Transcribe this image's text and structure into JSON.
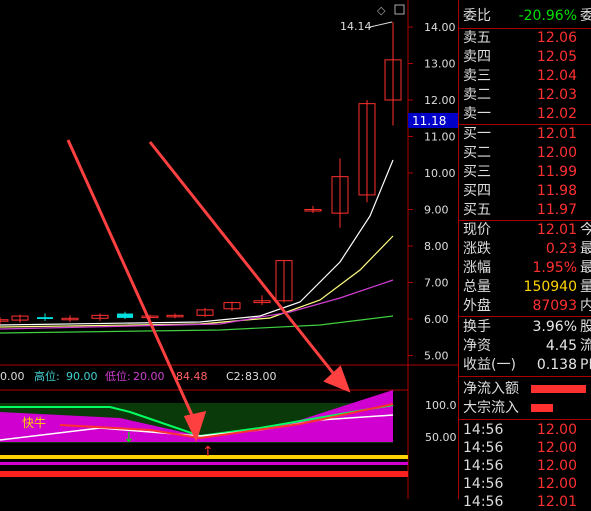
{
  "colors": {
    "up": "#ff3030",
    "down": "#00e000",
    "axis": "#b00000",
    "ma1": "#ffffff",
    "ma2": "#ffff80",
    "ma3": "#d040d0",
    "ma4": "#40d040",
    "arrow": "#ff4040"
  },
  "price_axis": {
    "ticks": [
      "14.00",
      "13.00",
      "12.00",
      "11.00",
      "10.00",
      "9.00",
      "8.00",
      "7.00",
      "6.00",
      "5.00"
    ],
    "current_marker": "11.18"
  },
  "high_label": "14.14",
  "candles": [
    {
      "o": 5.95,
      "h": 6.05,
      "l": 5.85,
      "c": 5.98
    },
    {
      "o": 5.97,
      "h": 6.12,
      "l": 5.9,
      "c": 6.08
    },
    {
      "o": 6.05,
      "h": 6.15,
      "l": 5.95,
      "c": 6.0
    },
    {
      "o": 6.0,
      "h": 6.1,
      "l": 5.92,
      "c": 6.02
    },
    {
      "o": 6.02,
      "h": 6.15,
      "l": 5.95,
      "c": 6.1
    },
    {
      "o": 6.15,
      "h": 6.2,
      "l": 6.0,
      "c": 6.03
    },
    {
      "o": 6.05,
      "h": 6.12,
      "l": 6.0,
      "c": 6.08
    },
    {
      "o": 6.08,
      "h": 6.15,
      "l": 6.02,
      "c": 6.1
    },
    {
      "o": 6.1,
      "h": 6.3,
      "l": 6.05,
      "c": 6.25
    },
    {
      "o": 6.28,
      "h": 6.48,
      "l": 6.22,
      "c": 6.45
    },
    {
      "o": 6.45,
      "h": 6.65,
      "l": 6.38,
      "c": 6.5
    },
    {
      "o": 6.5,
      "h": 7.6,
      "l": 6.45,
      "c": 7.6
    },
    {
      "o": 9.0,
      "h": 9.1,
      "l": 8.9,
      "c": 9.0
    },
    {
      "o": 8.9,
      "h": 10.4,
      "l": 8.5,
      "c": 9.9
    },
    {
      "o": 9.4,
      "h": 12.0,
      "l": 9.2,
      "c": 11.9
    },
    {
      "o": 12.0,
      "h": 14.14,
      "l": 11.3,
      "c": 13.1
    }
  ],
  "indicator": {
    "label_value": "0.00",
    "high_label": "高位:",
    "high_value": "90.00",
    "low_label": "低位:",
    "low_value": "20.00",
    "extra_value": "84.48",
    "c2_label": "C2:",
    "c2_value": "83.00",
    "axis_ticks": [
      "100.0",
      "50.00"
    ],
    "annotation": "快牛"
  },
  "order_book": {
    "weibi_label": "委比",
    "weibi_value": "-20.96%",
    "weibi_tail": "委",
    "asks": [
      {
        "label": "卖五",
        "price": "12.06"
      },
      {
        "label": "卖四",
        "price": "12.05"
      },
      {
        "label": "卖三",
        "price": "12.04"
      },
      {
        "label": "卖二",
        "price": "12.03"
      },
      {
        "label": "卖一",
        "price": "12.02"
      }
    ],
    "bids": [
      {
        "label": "买一",
        "price": "12.01"
      },
      {
        "label": "买二",
        "price": "12.00"
      },
      {
        "label": "买三",
        "price": "11.99"
      },
      {
        "label": "买四",
        "price": "11.98"
      },
      {
        "label": "买五",
        "price": "11.97"
      }
    ]
  },
  "quote": [
    {
      "label": "现价",
      "value": "12.01",
      "tail": "今"
    },
    {
      "label": "涨跌",
      "value": "0.23",
      "tail": "最"
    },
    {
      "label": "涨幅",
      "value": "1.95%",
      "tail": "最"
    },
    {
      "label": "总量",
      "value": "150940",
      "tail": "量"
    },
    {
      "label": "外盘",
      "value": "87093",
      "tail": "内"
    }
  ],
  "stats": [
    {
      "label": "换手",
      "value": "3.96%",
      "tail": "股"
    },
    {
      "label": "净资",
      "value": "4.45",
      "tail": "流"
    },
    {
      "label": "收益(一)",
      "value": "0.138",
      "tail": "PE"
    }
  ],
  "flows": [
    {
      "label": "净流入额"
    },
    {
      "label": "大宗流入"
    }
  ],
  "trades": [
    {
      "time": "14:56",
      "price": "12.00"
    },
    {
      "time": "14:56",
      "price": "12.00"
    },
    {
      "time": "14:56",
      "price": "12.00"
    },
    {
      "time": "14:56",
      "price": "12.00"
    },
    {
      "time": "14:56",
      "price": "12.01"
    }
  ]
}
